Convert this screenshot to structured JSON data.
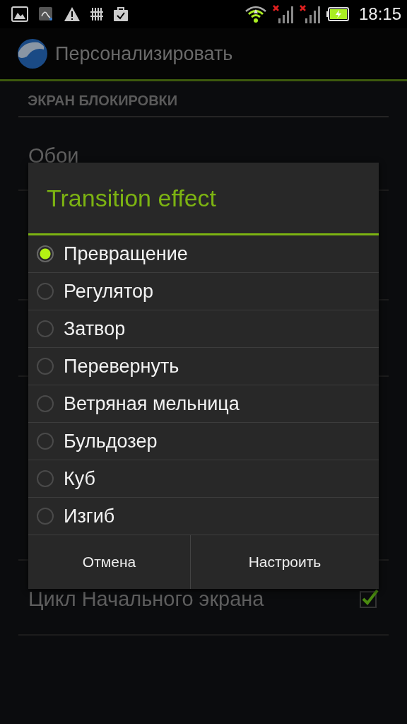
{
  "status_bar": {
    "time": "18:15"
  },
  "action_bar": {
    "title": "Персонализировать"
  },
  "settings": {
    "section": "ЭКРАН БЛОКИРОВКИ",
    "items": [
      {
        "label": "Обои"
      },
      {
        "label": "Цикл Начального экрана",
        "kind": "checkbox",
        "checked": true
      }
    ]
  },
  "dialog": {
    "title": "Transition effect",
    "options": [
      {
        "label": "Превращение",
        "selected": true
      },
      {
        "label": "Регулятор",
        "selected": false
      },
      {
        "label": "Затвор",
        "selected": false
      },
      {
        "label": "Перевернуть",
        "selected": false
      },
      {
        "label": "Ветряная мельница",
        "selected": false
      },
      {
        "label": "Бульдозер",
        "selected": false
      },
      {
        "label": "Куб",
        "selected": false
      },
      {
        "label": "Изгиб",
        "selected": false
      }
    ],
    "buttons": [
      "Отмена",
      "Настроить"
    ]
  }
}
